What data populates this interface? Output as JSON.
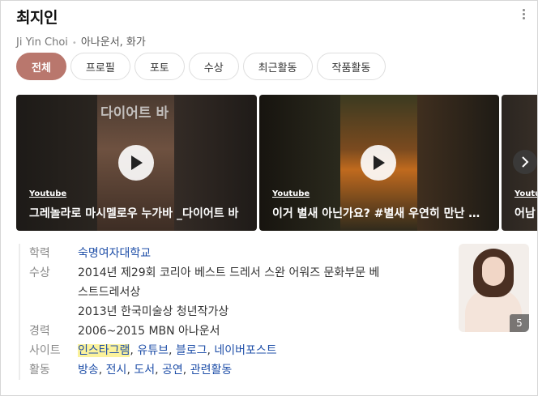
{
  "profile": {
    "name": "최지인",
    "latin_name": "Ji Yin Choi",
    "occupation": "아나운서, 화가"
  },
  "tabs": [
    {
      "label": "전체",
      "active": true
    },
    {
      "label": "프로필",
      "active": false
    },
    {
      "label": "포토",
      "active": false
    },
    {
      "label": "수상",
      "active": false
    },
    {
      "label": "최근활동",
      "active": false
    },
    {
      "label": "작품활동",
      "active": false
    }
  ],
  "videos": [
    {
      "source": "Youtube",
      "title": "그레놀라로 마시멜로우 누가바 _다이어트 바",
      "overlay_text": "다이어트 바",
      "icon": "play-icon"
    },
    {
      "source": "Youtube",
      "title": "이거 별새 아닌가요? #별새 우연히 만난 풍경",
      "icon": "play-icon"
    },
    {
      "source": "Youtube",
      "title": "어남"
    }
  ],
  "info": {
    "education": {
      "label": "학력",
      "value": "숙명여자대학교"
    },
    "awards": {
      "label": "수상",
      "line1": "2014년 제29회 코리아 베스트 드레서 스완 어워즈 문화부문 베",
      "line2": "스트드레서상",
      "line3": "2013년 한국미술상 청년작가상"
    },
    "career": {
      "label": "경력",
      "value": "2006~2015 MBN 아나운서"
    },
    "sites": {
      "label": "사이트",
      "links": [
        "인스타그램",
        "유튜브",
        "블로그",
        "네이버포스트"
      ]
    },
    "activities": {
      "label": "활동",
      "links": [
        "방송",
        "전시",
        "도서",
        "공연",
        "관련활동"
      ]
    }
  },
  "photo": {
    "count": "5"
  },
  "colors": {
    "accent": "#b9776d",
    "link": "#1f4fa8",
    "highlight": "#fbf29c"
  }
}
